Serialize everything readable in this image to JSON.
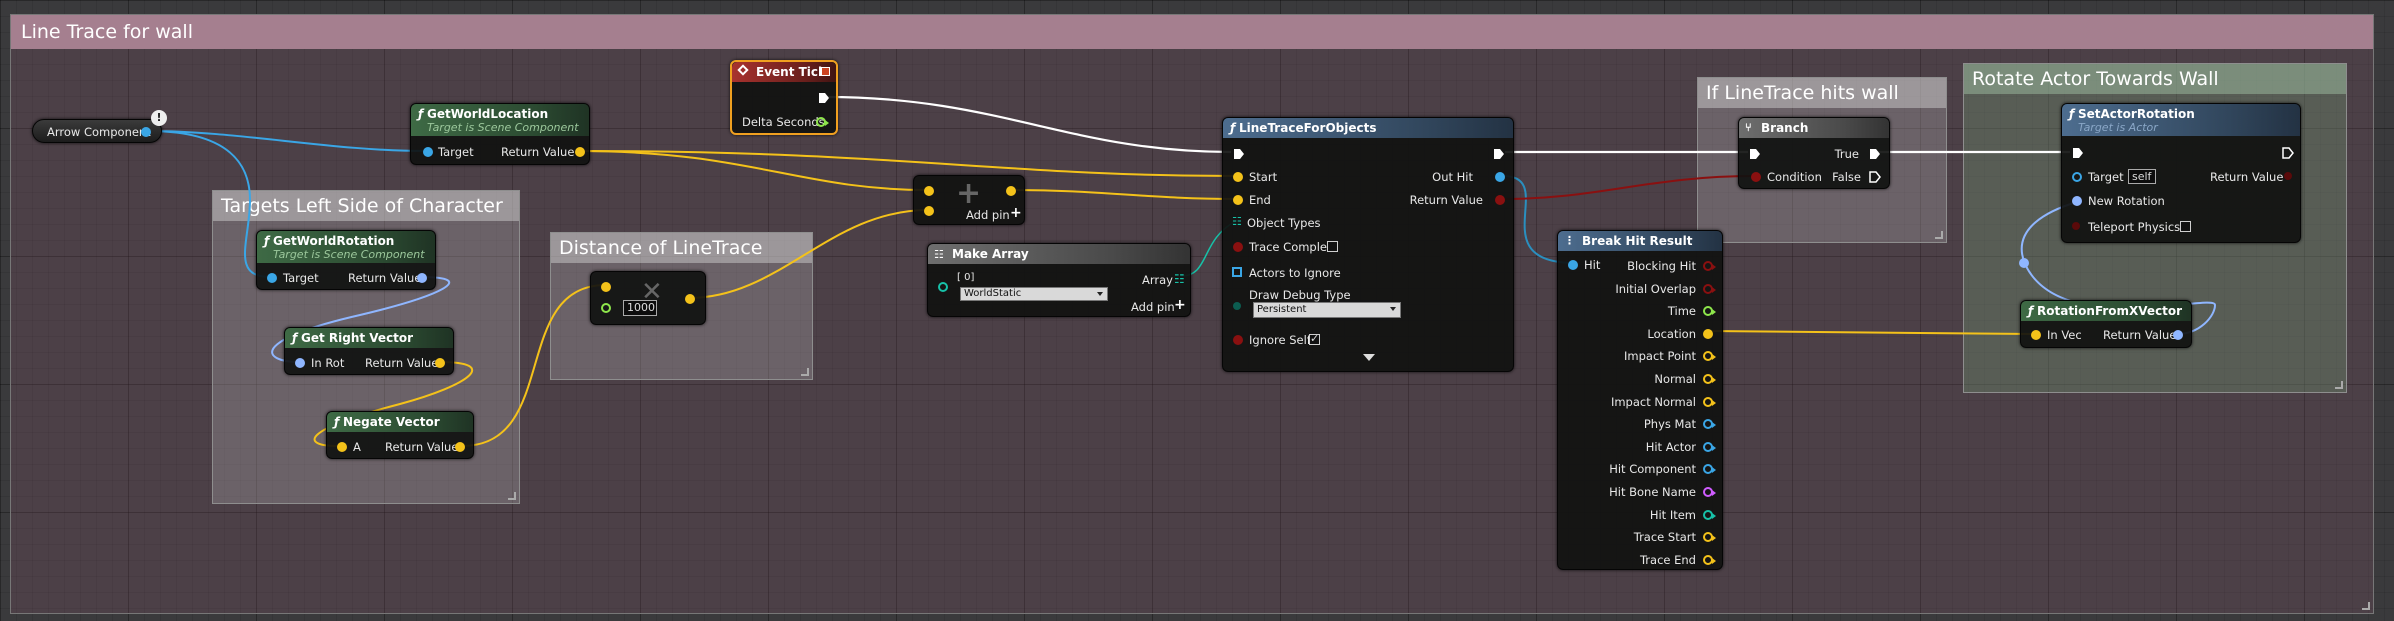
{
  "colors": {
    "exec": "#ffffff",
    "vector": "#f4c21a",
    "object": "#3aa6e6",
    "rotator": "#8fb6ff",
    "struct": "#8a1010",
    "event_header": "#a8322e",
    "function_header": "#3e6a45",
    "pure_header": "#4d6d8f"
  },
  "main_comment": {
    "title": "Line Trace for wall"
  },
  "comments": {
    "targets_left": {
      "title": "Targets Left Side of Character"
    },
    "distance": {
      "title": "Distance of LineTrace"
    },
    "if_hits": {
      "title": "If LineTrace hits wall"
    },
    "rotate": {
      "title": "Rotate Actor Towards Wall"
    }
  },
  "nodes": {
    "arrow_component": {
      "label": "Arrow Component"
    },
    "gwl1": {
      "title": "GetWorldLocation",
      "subtitle": "Target is Scene Component",
      "pin_target": "Target",
      "pin_return": "Return Value"
    },
    "gwr": {
      "title": "GetWorldRotation",
      "subtitle": "Target is Scene Component",
      "pin_target": "Target",
      "pin_return": "Return Value"
    },
    "grv": {
      "title": "Get Right Vector",
      "pin_in": "In Rot",
      "pin_return": "Return Value"
    },
    "negate": {
      "title": "Negate Vector",
      "pin_a": "A",
      "pin_return": "Return Value"
    },
    "multiply": {
      "value": "1000"
    },
    "event_tick": {
      "title": "Event Tick",
      "pin_delta": "Delta Seconds"
    },
    "add": {
      "pin_add": "Add pin"
    },
    "make_array": {
      "title": "Make Array",
      "pin_index": "[ 0]",
      "pin_value": "WorldStatic",
      "pin_array": "Array",
      "pin_add": "Add pin"
    },
    "trace": {
      "title": "LineTraceForObjects",
      "pins_in": [
        "Start",
        "End",
        "Object Types",
        "Trace Complex",
        "Actors to Ignore",
        "Draw Debug Type",
        "Ignore Self"
      ],
      "debug_value": "Persistent",
      "pins_out": [
        "Out Hit",
        "Return Value"
      ]
    },
    "break_hit": {
      "title": "Break Hit Result",
      "pin_hit": "Hit",
      "pins_out": [
        "Blocking Hit",
        "Initial Overlap",
        "Time",
        "Location",
        "Impact Point",
        "Normal",
        "Impact Normal",
        "Phys Mat",
        "Hit Actor",
        "Hit Component",
        "Hit Bone Name",
        "Hit Item",
        "Trace Start",
        "Trace End"
      ]
    },
    "branch": {
      "title": "Branch",
      "pin_condition": "Condition",
      "pin_true": "True",
      "pin_false": "False"
    },
    "set_rot": {
      "title": "SetActorRotation",
      "subtitle": "Target is Actor",
      "pin_target": "Target",
      "target_value": "self",
      "pin_new_rot": "New Rotation",
      "pin_teleport": "Teleport Physics",
      "pin_return": "Return Value"
    },
    "rot_from_x": {
      "title": "RotationFromXVector",
      "pin_in": "In Vec",
      "pin_return": "Return Value"
    }
  }
}
